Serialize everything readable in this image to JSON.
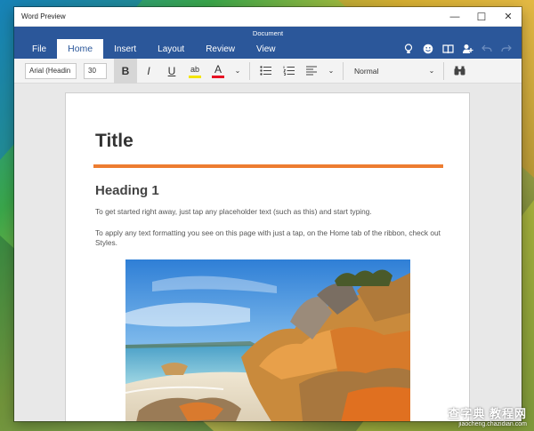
{
  "window": {
    "app_title": "Word Preview",
    "document_name": "Document",
    "controls": {
      "minimize": "—",
      "maximize": "☐",
      "close": "✕"
    }
  },
  "ribbon_tabs": [
    "File",
    "Home",
    "Insert",
    "Layout",
    "Review",
    "View"
  ],
  "active_tab": "Home",
  "tab_tools": [
    {
      "name": "lightbulb-icon",
      "glyph": "💡"
    },
    {
      "name": "smiley-icon",
      "glyph": "☻"
    },
    {
      "name": "book-icon",
      "glyph": "▥"
    },
    {
      "name": "share-icon",
      "glyph": "👥"
    },
    {
      "name": "undo-icon",
      "glyph": "↶"
    },
    {
      "name": "redo-icon",
      "glyph": "↷"
    }
  ],
  "home_ribbon": {
    "font_name": "Arial (Headin",
    "font_size": "30",
    "bold": "B",
    "italic": "I",
    "underline": "U",
    "highlight": "ab",
    "font_color": "A",
    "dropdown": "⌄",
    "style": "Normal",
    "find_glyph": "👀"
  },
  "document": {
    "title": "Title",
    "heading": "Heading 1",
    "paragraph1": "To get started right away, just tap any placeholder text (such as this) and start typing.",
    "paragraph2": "To apply any text formatting you see on this page with just a tap, on the Home tab of the ribbon, check out Styles."
  },
  "colors": {
    "brand_blue": "#2b579a",
    "title_rule": "#ed7d31",
    "highlight": "#f3e500",
    "font_color": "#e81123"
  },
  "watermark": {
    "top": "查字典 教程网",
    "bottom": "jiaocheng.chazidian.com"
  }
}
